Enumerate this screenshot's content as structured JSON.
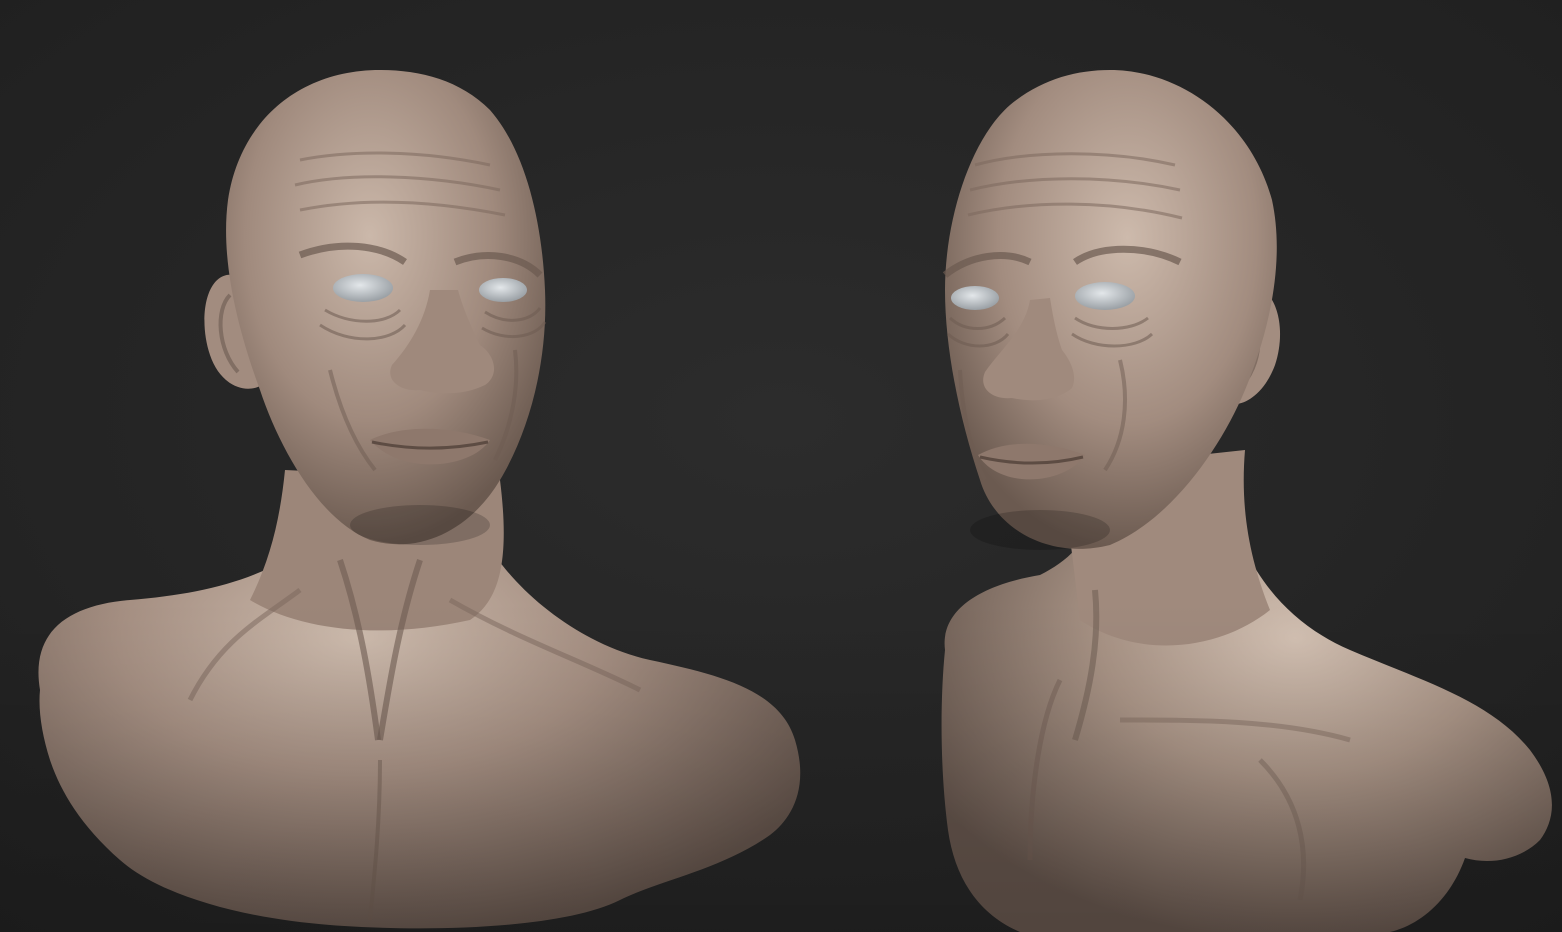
{
  "scene": {
    "background_color": "#262626",
    "material_color": "#a58f82",
    "material_highlight": "#cdbbad",
    "material_shadow": "#5f5048",
    "eye_color": "#c9ced3",
    "busts": [
      {
        "view": "three-quarter-right"
      },
      {
        "view": "three-quarter-left"
      }
    ]
  }
}
